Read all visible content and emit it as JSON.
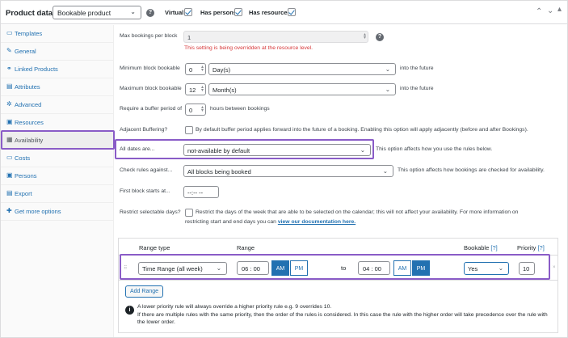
{
  "header": {
    "title": "Product data —",
    "product_type": "Bookable product",
    "virtual_label": "Virtual:",
    "has_persons_label": "Has persons:",
    "has_resources_label": "Has resources:"
  },
  "sidebar": {
    "items": [
      {
        "label": "Templates",
        "icon": "template-icon"
      },
      {
        "label": "General",
        "icon": "wrench-icon"
      },
      {
        "label": "Linked Products",
        "icon": "link-icon"
      },
      {
        "label": "Attributes",
        "icon": "list-icon"
      },
      {
        "label": "Advanced",
        "icon": "gear-icon"
      },
      {
        "label": "Resources",
        "icon": "resources-icon"
      },
      {
        "label": "Availability",
        "icon": "calendar-icon"
      },
      {
        "label": "Costs",
        "icon": "costs-icon"
      },
      {
        "label": "Persons",
        "icon": "persons-icon"
      },
      {
        "label": "Export",
        "icon": "export-icon"
      },
      {
        "label": "Get more options",
        "icon": "plugin-icon"
      }
    ],
    "active": "Availability"
  },
  "fields": {
    "max_bookings_label": "Max bookings per block",
    "max_bookings_value": "1",
    "max_bookings_warning": "This setting is being overridden at the resource level.",
    "min_block_label": "Minimum block bookable",
    "min_block_value": "0",
    "min_block_unit": "Day(s)",
    "min_block_suffix": "into the future",
    "max_block_label": "Maximum block bookable",
    "max_block_value": "12",
    "max_block_unit": "Month(s)",
    "max_block_suffix": "into the future",
    "buffer_label": "Require a buffer period of",
    "buffer_value": "0",
    "buffer_suffix": "hours between bookings",
    "adjacent_label": "Adjacent Buffering?",
    "adjacent_text": "By default buffer period applies forward into the future of a booking. Enabling this option will apply adjacently (before and after Bookings).",
    "all_dates_label": "All dates are...",
    "all_dates_value": "not-available by default",
    "all_dates_help": "This option affects how you use the rules below.",
    "check_rules_label": "Check rules against...",
    "check_rules_value": "All blocks being booked",
    "check_rules_help": "This option affects how bookings are checked for availability.",
    "first_block_label": "First block starts at...",
    "first_block_value": "--:--  --",
    "restrict_label": "Restrict selectable days?",
    "restrict_text_1": "Restrict the days of the week that are able to be selected on the calendar; this will not affect your availability. For more information on",
    "restrict_text_2": "restricting start and end days you can",
    "restrict_link": "view our documentation here."
  },
  "ranges": {
    "headers": {
      "range_type": "Range type",
      "range": "Range",
      "bookable": "Bookable",
      "bookable_help": "[?]",
      "priority": "Priority",
      "priority_help": "[?]"
    },
    "rows": [
      {
        "type": "Time Range (all week)",
        "from_h": "06",
        "from_m": "00",
        "from_period": "AM",
        "to_label": "to",
        "to_h": "04",
        "to_m": "00",
        "to_period": "PM",
        "bookable": "Yes",
        "priority": "10"
      }
    ],
    "am_label": "AM",
    "pm_label": "PM",
    "add_button": "Add Range",
    "info_line_1": "A lower priority rule will always override a higher priority rule e.g. 9 overrides 10.",
    "info_line_2": "If there are multiple rules with the same priority, then the order of the rules is considered. In this case the rule with the higher order will take precedence over the rule with the lower order."
  },
  "colors": {
    "accent": "#2271b1",
    "highlight": "#8a5cc7",
    "warning": "#d63638"
  }
}
